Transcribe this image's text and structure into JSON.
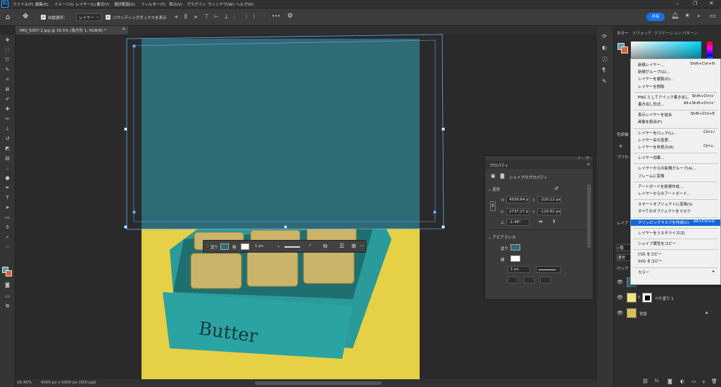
{
  "app": {
    "logo": "Ps"
  },
  "menu": [
    "ファイル(F)",
    "編集(E)",
    "イメージ(I)",
    "レイヤー(L)",
    "書式(Y)",
    "選択範囲(S)",
    "フィルター(T)",
    "表示(V)",
    "プラグイン",
    "ウィンドウ(W)",
    "ヘルプ(H)"
  ],
  "options": {
    "auto_select_label": "自動選択：",
    "auto_select_value": "レイヤー",
    "bbox_label": "バウンディングボックスを表示",
    "more": "•••",
    "share": "共有"
  },
  "document": {
    "tab": "IMG_6387-2.jpg @ 16.5% (長方形 1, RGB/8) *"
  },
  "status": {
    "zoom": "16.45%",
    "info": "4000 px x 6000 px (350 ppi)"
  },
  "context_bar": {
    "fill": "塗り",
    "stroke": "線",
    "stroke_width": "1 px"
  },
  "properties": {
    "title": "プロパティ",
    "subtitle": "シェイプのプロパティ",
    "transform_label": "変形",
    "w_label": "W",
    "w": "4509.64 p",
    "x_label": "X",
    "x": "-220.12 px",
    "h_label": "H",
    "h": "2737.27 p",
    "y_label": "Y",
    "y": "-119.62 px",
    "angle": "-1.48°",
    "appearance_label": "アピアランス",
    "fill_label": "塗り",
    "stroke_label": "線",
    "stroke_width": "1 px"
  },
  "color_tabs": [
    "カラー",
    "スウォッチ",
    "グラデーション",
    "パターン"
  ],
  "layers": [
    {
      "name": "ベた塗り 1",
      "locked": false
    },
    {
      "name": "背景",
      "locked": true
    }
  ],
  "context_menu": {
    "groups": [
      [
        {
          "label": "新規レイヤー...",
          "key": "Shift+Ctrl+N"
        },
        {
          "label": "新規グループ(G)...",
          "key": ""
        },
        {
          "label": "レイヤーを複製(D)...",
          "key": ""
        },
        {
          "label": "レイヤーを削除",
          "key": ""
        }
      ],
      [
        {
          "label": "PNG としてクイック書き出し",
          "key": "Shift+Ctrl+'"
        },
        {
          "label": "書き出し形式...",
          "key": "Alt+Shift+Ctrl+'"
        }
      ],
      [
        {
          "label": "表示レイヤーを結合",
          "key": "Shift+Ctrl+E"
        },
        {
          "label": "画像を統合(F)",
          "key": ""
        }
      ],
      [
        {
          "label": "レイヤーをロック(L)...",
          "key": "Ctrl+/"
        },
        {
          "label": "レイヤー名の変更...",
          "key": ""
        },
        {
          "label": "レイヤーを非表示(R)",
          "key": "Ctrl+,"
        }
      ],
      [
        {
          "label": "レイヤー効果...",
          "key": ""
        }
      ],
      [
        {
          "label": "レイヤーからの新規グループ(A)...",
          "key": ""
        },
        {
          "label": "フレームに変換",
          "key": ""
        }
      ],
      [
        {
          "label": "アートボードを新規作成...",
          "key": ""
        },
        {
          "label": "レイヤーからのアートボード...",
          "key": ""
        }
      ],
      [
        {
          "label": "スマートオブジェクトに変換(S)",
          "key": ""
        },
        {
          "label": "すべてのオブジェクトをマスク",
          "key": ""
        }
      ],
      [
        {
          "label": "クリッピングマスクを作成(C)",
          "key": "Alt+Ctrl+G",
          "highlight": true
        }
      ],
      [
        {
          "label": "レイヤーをラスタライズ(Z)",
          "key": ""
        }
      ],
      [
        {
          "label": "シェイプ属性をコピー",
          "key": ""
        }
      ],
      [
        {
          "label": "CSS をコピー",
          "key": ""
        },
        {
          "label": "SVG をコピー",
          "key": ""
        }
      ],
      [
        {
          "label": "カラー",
          "key": "",
          "submenu": true
        }
      ]
    ]
  },
  "colors": {
    "teal": "#2f6b75",
    "yellow": "#e8d24a",
    "accent": "#1473e6",
    "highlight": "#1665d8"
  }
}
